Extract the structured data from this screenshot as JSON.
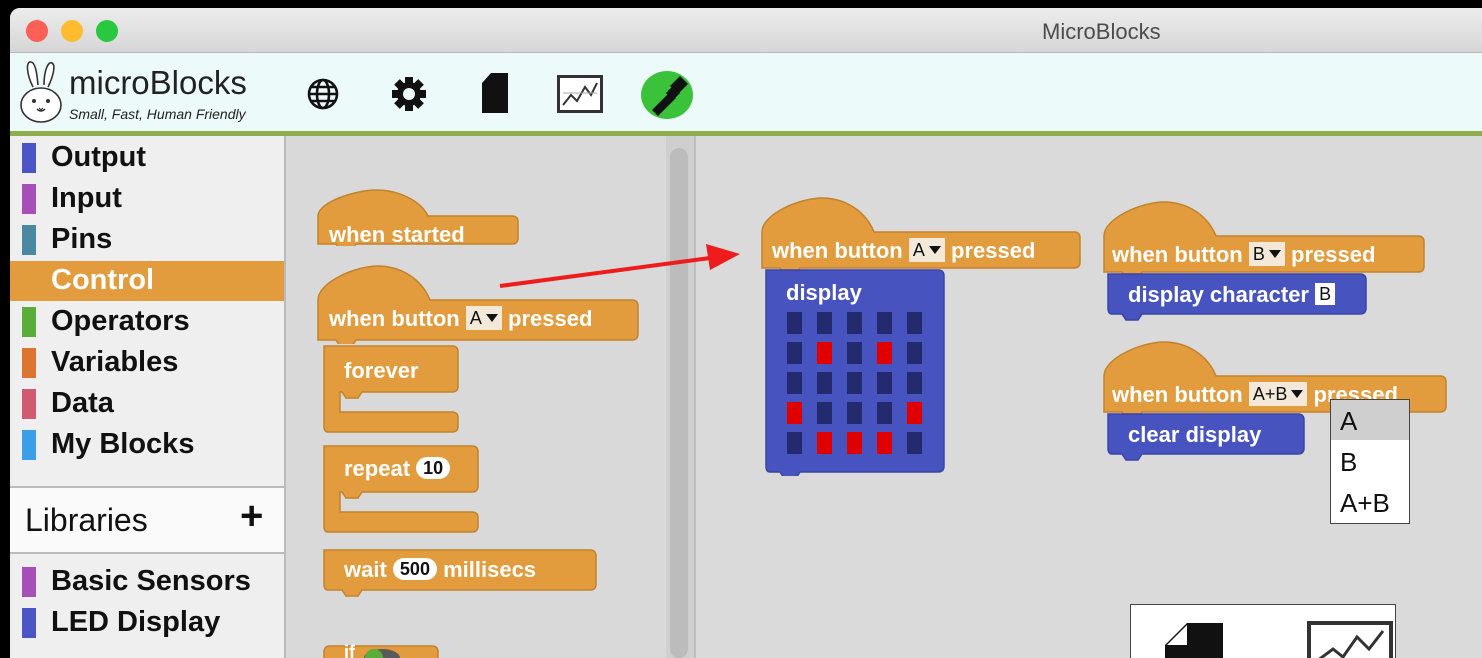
{
  "window": {
    "title": "MicroBlocks"
  },
  "logo": {
    "name": "microBlocks",
    "tagline": "Small, Fast, Human Friendly"
  },
  "toolbar": {
    "icons": [
      "globe-icon",
      "gear-icon",
      "file-icon",
      "graph-icon",
      "usb-connected-icon"
    ],
    "connected_color": "#3bc23b"
  },
  "categories": [
    {
      "label": "Output",
      "color": "#4c55c6"
    },
    {
      "label": "Input",
      "color": "#a64fb7"
    },
    {
      "label": "Pins",
      "color": "#4a8aa0"
    },
    {
      "label": "Control",
      "color": "#e29c3e",
      "selected": true
    },
    {
      "label": "Operators",
      "color": "#5aad3a"
    },
    {
      "label": "Variables",
      "color": "#dd7530"
    },
    {
      "label": "Data",
      "color": "#d05a70"
    },
    {
      "label": "My Blocks",
      "color": "#3a9ee8"
    }
  ],
  "libraries": {
    "label": "Libraries",
    "add_symbol": "+"
  },
  "library_items": [
    {
      "label": "Basic Sensors",
      "color": "#a64fb7"
    },
    {
      "label": "LED Display",
      "color": "#4c55c6"
    }
  ],
  "palette_blocks": {
    "when_started": "when started",
    "when_button": {
      "prefix": "when button",
      "value": "A",
      "suffix": "pressed"
    },
    "forever": "forever",
    "repeat": {
      "label": "repeat",
      "value": "10"
    },
    "wait": {
      "label": "wait",
      "value": "500",
      "suffix": "millisecs"
    },
    "if": "if"
  },
  "scripts": {
    "script1": {
      "hat_prefix": "when button",
      "hat_value": "A",
      "hat_suffix": "pressed",
      "command": "display",
      "leds": [
        [
          0,
          0,
          0,
          0,
          0
        ],
        [
          0,
          1,
          0,
          1,
          0
        ],
        [
          0,
          0,
          0,
          0,
          0
        ],
        [
          1,
          0,
          0,
          0,
          1
        ],
        [
          0,
          1,
          1,
          1,
          0
        ]
      ],
      "led_on": "#e00000",
      "led_off": "#232a6e"
    },
    "script2": {
      "hat_prefix": "when button",
      "hat_value": "B",
      "hat_suffix": "pressed",
      "command": "display character",
      "command_value": "B"
    },
    "script3": {
      "hat_prefix": "when button",
      "hat_value": "A+B",
      "hat_suffix": "pressed",
      "command": "clear display"
    }
  },
  "dropdown_menu": {
    "options": [
      "A",
      "B",
      "A+B"
    ],
    "highlighted": "A"
  },
  "arrow_color": "#ee1c1c"
}
